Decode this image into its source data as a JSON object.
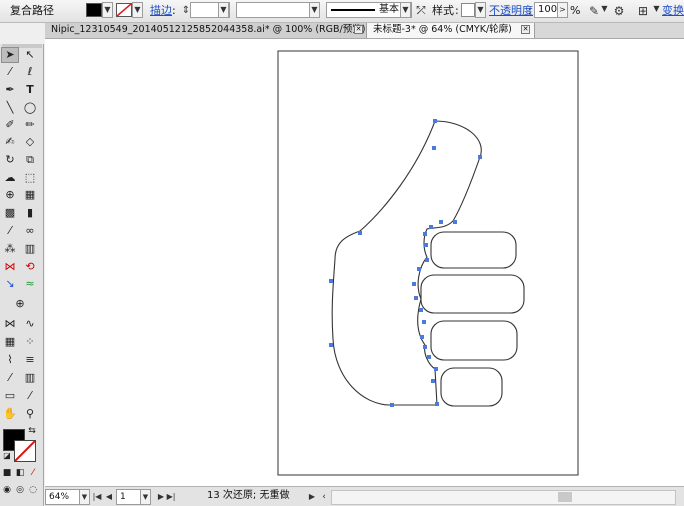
{
  "control_bar": {
    "path_label": "复合路径",
    "stroke_label": "描边",
    "stroke_profile": "基本",
    "style_label": "样式",
    "opacity_label": "不透明度",
    "opacity_value": "100",
    "opacity_unit": "%",
    "transform_label": "变换",
    "fill_color": "#000000",
    "stroke_color": "none"
  },
  "tabs": [
    {
      "label": "Nipic_12310549_20140512125852044358.ai* @ 100% (RGB/预览)",
      "active": false
    },
    {
      "label": "未标题-3* @ 64% (CMYK/轮廓)",
      "active": true
    }
  ],
  "tools": [
    "selection-tool",
    "direct-selection-tool",
    "magic-wand-tool",
    "lasso-tool",
    "pen-tool",
    "type-tool",
    "line-segment-tool",
    "ellipse-tool",
    "paintbrush-tool",
    "pencil-tool",
    "blob-brush-tool",
    "eraser-tool",
    "rotate-tool",
    "scale-tool",
    "warp-tool",
    "free-transform-tool",
    "shape-builder-tool",
    "perspective-grid-tool",
    "mesh-tool",
    "gradient-tool",
    "eyedropper-tool",
    "blend-tool",
    "symbol-sprayer-tool",
    "column-graph-tool",
    "artboard-tool",
    "slice-tool",
    "hand-tool",
    "zoom-tool"
  ],
  "status": {
    "zoom": "64%",
    "page": "1",
    "message": "13 次还原; 无重做"
  }
}
